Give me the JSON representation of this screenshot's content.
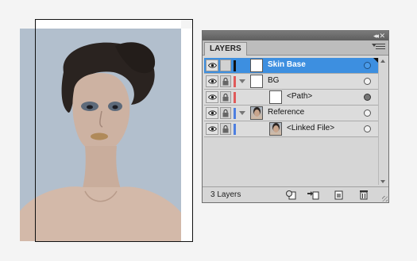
{
  "panel": {
    "tab_label": "LAYERS",
    "collapse_glyph": "◂◂",
    "close_glyph": "✕",
    "footer_count": "3 Layers"
  },
  "layers": [
    {
      "name": "Skin Base",
      "selected": true,
      "locked": false,
      "color": "#111111",
      "expandable": false,
      "thumb": "blank",
      "indent": 0,
      "target": "selected"
    },
    {
      "name": "BG",
      "selected": false,
      "locked": true,
      "color": "#e05a5a",
      "expandable": true,
      "thumb": "blank",
      "indent": 0,
      "target": "empty"
    },
    {
      "name": "<Path>",
      "selected": false,
      "locked": true,
      "color": "#e05a5a",
      "expandable": false,
      "thumb": "blank",
      "indent": 1,
      "target": "filled"
    },
    {
      "name": "Reference",
      "selected": false,
      "locked": true,
      "color": "#4d7fe0",
      "expandable": true,
      "thumb": "photo",
      "indent": 0,
      "target": "empty"
    },
    {
      "name": "<Linked File>",
      "selected": false,
      "locked": true,
      "color": "#4d7fe0",
      "expandable": false,
      "thumb": "photo",
      "indent": 1,
      "target": "empty"
    }
  ],
  "icons": {
    "visibility": "eye-icon",
    "lock": "lock-icon",
    "footer": [
      "make-clipping-mask-icon",
      "create-sublayer-icon",
      "create-layer-icon",
      "delete-icon"
    ]
  }
}
